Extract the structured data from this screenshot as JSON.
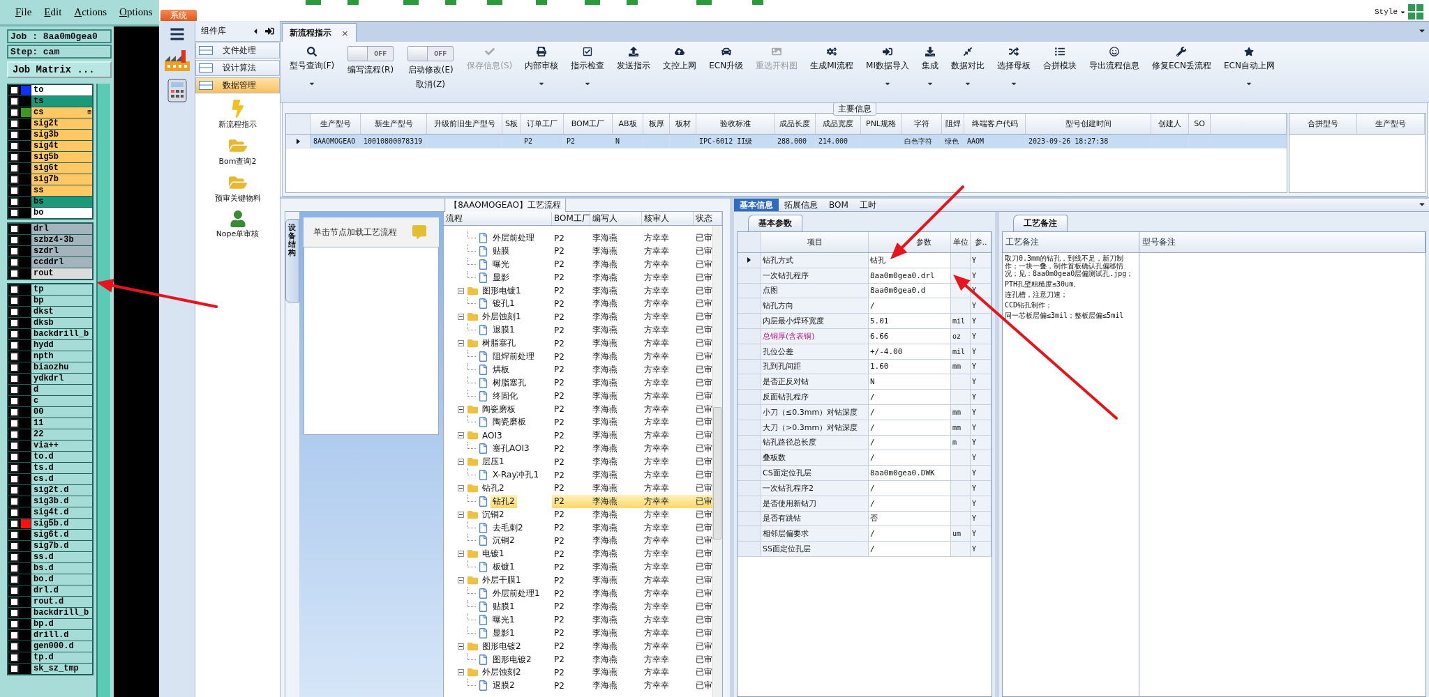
{
  "left_panel": {
    "menu": [
      "File",
      "Edit",
      "Actions",
      "Options"
    ],
    "job": "Job : 8aa0m0gea0",
    "step": "Step: cam",
    "matrix_button": "Job Matrix ...",
    "layer_groups": [
      {
        "layers": [
          {
            "name": "to",
            "color": "#ffffff",
            "swatch": {
              "color": "#1030ff"
            },
            "checked": false
          },
          {
            "name": "ts",
            "color": "#1a9a7a",
            "checked": false
          },
          {
            "name": "cs",
            "color": "#ffc864",
            "swatch": {
              "color": "#3a9a20"
            },
            "mark": "⊞",
            "checked": false
          },
          {
            "name": "sig2t",
            "color": "#ffc864",
            "checked": false
          },
          {
            "name": "sig3b",
            "color": "#ffc864",
            "checked": false
          },
          {
            "name": "sig4t",
            "color": "#ffc864",
            "checked": false
          },
          {
            "name": "sig5b",
            "color": "#ffc864",
            "checked": false
          },
          {
            "name": "sig6t",
            "color": "#ffc864",
            "checked": false
          },
          {
            "name": "sig7b",
            "color": "#ffc864",
            "checked": false
          },
          {
            "name": "ss",
            "color": "#ffc864",
            "checked": false
          },
          {
            "name": "bs",
            "color": "#1a9a7a",
            "checked": false
          },
          {
            "name": "bo",
            "color": "#ffffff",
            "checked": false
          }
        ]
      },
      {
        "layers": [
          {
            "name": "drl",
            "color": "#a4b4bc",
            "checked": false
          },
          {
            "name": "szbz4-3b",
            "color": "#a4b4bc",
            "checked": false
          },
          {
            "name": "szdrl",
            "color": "#a4b4bc",
            "checked": false
          },
          {
            "name": "ccddrl",
            "color": "#a4b4bc",
            "checked": false
          },
          {
            "name": "rout",
            "color": "#dcdcdc",
            "checked": false
          }
        ]
      },
      {
        "layers": [
          {
            "name": "tp",
            "color": "#a6dcd8",
            "checked": false
          },
          {
            "name": "bp",
            "color": "#a6dcd8",
            "checked": false
          },
          {
            "name": "dkst",
            "color": "#a6dcd8",
            "checked": false
          },
          {
            "name": "dksb",
            "color": "#a6dcd8",
            "checked": false
          },
          {
            "name": "backdrill_b",
            "color": "#a6dcd8",
            "checked": false
          },
          {
            "name": "hydd",
            "color": "#a6dcd8",
            "checked": false
          },
          {
            "name": "npth",
            "color": "#a6dcd8",
            "checked": false
          },
          {
            "name": "biaozhu",
            "color": "#a6dcd8",
            "checked": false
          },
          {
            "name": "ydkdrl",
            "color": "#a6dcd8",
            "checked": false
          },
          {
            "name": "d",
            "color": "#a6dcd8",
            "checked": false
          },
          {
            "name": "c",
            "color": "#a6dcd8",
            "checked": false
          },
          {
            "name": "00",
            "color": "#a6dcd8",
            "checked": false
          },
          {
            "name": "11",
            "color": "#a6dcd8",
            "checked": false
          },
          {
            "name": "22",
            "color": "#a6dcd8",
            "checked": false
          },
          {
            "name": "via++",
            "color": "#a6dcd8",
            "checked": false
          },
          {
            "name": "to.d",
            "color": "#a6dcd8",
            "checked": false
          },
          {
            "name": "ts.d",
            "color": "#a6dcd8",
            "checked": false
          },
          {
            "name": "cs.d",
            "color": "#a6dcd8",
            "checked": false
          },
          {
            "name": "sig2t.d",
            "color": "#a6dcd8",
            "checked": false
          },
          {
            "name": "sig3b.d",
            "color": "#a6dcd8",
            "checked": false
          },
          {
            "name": "sig4t.d",
            "color": "#a6dcd8",
            "checked": false
          },
          {
            "name": "sig5b.d",
            "color": "#a6dcd8",
            "swatch": {
              "color": "#ff1010"
            },
            "checked": false
          },
          {
            "name": "sig6t.d",
            "color": "#a6dcd8",
            "checked": false
          },
          {
            "name": "sig7b.d",
            "color": "#a6dcd8",
            "checked": false
          },
          {
            "name": "ss.d",
            "color": "#a6dcd8",
            "checked": false
          },
          {
            "name": "bs.d",
            "color": "#a6dcd8",
            "checked": false
          },
          {
            "name": "bo.d",
            "color": "#a6dcd8",
            "checked": false
          },
          {
            "name": "drl.d",
            "color": "#a6dcd8",
            "checked": false
          },
          {
            "name": "rout.d",
            "color": "#a6dcd8",
            "checked": false
          },
          {
            "name": "backdrill_b",
            "color": "#a6dcd8",
            "checked": false
          },
          {
            "name": "bp.d",
            "color": "#a6dcd8",
            "checked": false
          },
          {
            "name": "drill.d",
            "color": "#a6dcd8",
            "checked": false
          },
          {
            "name": "gen000.d",
            "color": "#a6dcd8",
            "checked": false
          },
          {
            "name": "tp.d",
            "color": "#a6dcd8",
            "checked": false
          },
          {
            "name": "sk_sz_tmp",
            "color": "#a6dcd8",
            "checked": false
          }
        ]
      }
    ]
  },
  "app": {
    "system_tab": "系统",
    "style_menu": "Style",
    "component_library": {
      "title": "组件库",
      "categories": [
        {
          "label": "文件处理",
          "selected": false
        },
        {
          "label": "设计算法",
          "selected": false
        },
        {
          "label": "数据管理",
          "selected": true
        }
      ],
      "items": [
        "新流程指示",
        "Bom查询2",
        "预审关键物料",
        "Nope单审核"
      ]
    },
    "doc_tabs": [
      {
        "label": "新流程指示",
        "close": "×",
        "selected": true
      }
    ],
    "toolbar": [
      {
        "kind": "button",
        "label": "型号查询(F)",
        "dropdown": true,
        "disabled": false
      },
      {
        "kind": "toggle",
        "label": "编写流程(R)",
        "switch": "OFF",
        "on": false
      },
      {
        "kind": "toggle",
        "label": "启动修改(E)",
        "label2": "取消(Z)",
        "switch": "OFF",
        "on": false
      },
      {
        "kind": "button",
        "label": "保存信息(S)",
        "dropdown": false,
        "disabled": true
      },
      {
        "kind": "button",
        "label": "内部审核",
        "dropdown": true,
        "disabled": false
      },
      {
        "kind": "button",
        "label": "指示检查",
        "dropdown": true,
        "disabled": false
      },
      {
        "kind": "button",
        "label": "发送指示",
        "dropdown": false,
        "disabled": false
      },
      {
        "kind": "button",
        "label": "文控上网",
        "dropdown": false,
        "disabled": false
      },
      {
        "kind": "button",
        "label": "ECN升级",
        "dropdown": false,
        "disabled": false
      },
      {
        "kind": "button",
        "label": "重选开料图",
        "dropdown": false,
        "disabled": true
      },
      {
        "kind": "button",
        "label": "生成MI流程",
        "dropdown": false,
        "disabled": false
      },
      {
        "kind": "button",
        "label": "MI数据导入",
        "dropdown": true,
        "disabled": false
      },
      {
        "kind": "button",
        "label": "集成",
        "dropdown": true,
        "disabled": false
      },
      {
        "kind": "button",
        "label": "数据对比",
        "dropdown": true,
        "disabled": false
      },
      {
        "kind": "button",
        "label": "选择母板",
        "dropdown": true,
        "disabled": false
      },
      {
        "kind": "button",
        "label": "合拼模块",
        "dropdown": false,
        "disabled": false
      },
      {
        "kind": "button",
        "label": "导出流程信息",
        "dropdown": false,
        "disabled": false
      },
      {
        "kind": "button",
        "label": "修复ECN丢流程",
        "dropdown": false,
        "disabled": false
      },
      {
        "kind": "button",
        "label": "ECN自动上网",
        "dropdown": true,
        "disabled": false
      }
    ],
    "main_info": {
      "title": "主要信息",
      "columns": [
        "生产型号",
        "新生产型号",
        "升级前旧生产型号",
        "S板",
        "订单工厂",
        "BOM工厂",
        "AB板",
        "板厚",
        "板材",
        "验收标准",
        "成品长度",
        "成品宽度",
        "PNL规格",
        "字符",
        "阻焊",
        "终端客户代码",
        "型号创建时间",
        "创建人",
        "SO"
      ],
      "rows": [
        {
          "selected": true,
          "cells": [
            "8AAOMOGEAO",
            "10010800078319",
            "",
            "",
            "P2",
            "P2",
            "N",
            "",
            "",
            "IPC-6012 II级",
            "288.000",
            "214.000",
            "",
            "白色字符",
            "绿色",
            "AAOM",
            "2023-09-26 18:27:38",
            "",
            ""
          ]
        }
      ]
    },
    "merge_table": {
      "columns": [
        "合拼型号",
        "生产型号"
      ]
    },
    "flow": {
      "title": "【8AAOMOGEAO】工艺流程",
      "side_tab": "设备结构",
      "hint": "单击节点加载工艺流程",
      "columns": [
        "流程",
        "BOM工厂",
        "编写人",
        "核审人",
        "状态"
      ],
      "tree": [
        {
          "children": [
            {
              "label": "外层前处理",
              "bom": "P2",
              "writer": "李海燕",
              "reviewer": "方幸幸",
              "status": "已审",
              "selected": false
            },
            {
              "label": "贴膜",
              "bom": "P2",
              "writer": "李海燕",
              "reviewer": "方幸幸",
              "status": "已审",
              "selected": false
            },
            {
              "label": "曝光",
              "bom": "P2",
              "writer": "李海燕",
              "reviewer": "方幸幸",
              "status": "已审",
              "selected": false
            },
            {
              "label": "显影",
              "bom": "P2",
              "writer": "李海燕",
              "reviewer": "方幸幸",
              "status": "已审",
              "selected": false
            }
          ]
        },
        {
          "label": "图形电镀1",
          "bom": "P2",
          "writer": "李海燕",
          "reviewer": "方幸幸",
          "status": "已审",
          "selected": false,
          "expanded": true,
          "children": [
            {
              "label": "镀孔1",
              "bom": "P2",
              "writer": "李海燕",
              "reviewer": "方幸幸",
              "status": "已审",
              "selected": false
            }
          ]
        },
        {
          "label": "外层蚀刻1",
          "bom": "P2",
          "writer": "李海燕",
          "reviewer": "方幸幸",
          "status": "已审",
          "selected": false,
          "expanded": true,
          "children": [
            {
              "label": "退膜1",
              "bom": "P2",
              "writer": "李海燕",
              "reviewer": "方幸幸",
              "status": "已审",
              "selected": false
            }
          ]
        },
        {
          "label": "树脂塞孔",
          "bom": "P2",
          "writer": "李海燕",
          "reviewer": "方幸幸",
          "status": "已审",
          "selected": false,
          "expanded": true,
          "children": [
            {
              "label": "阻焊前处理",
              "bom": "P2",
              "writer": "李海燕",
              "reviewer": "方幸幸",
              "status": "已审",
              "selected": false
            },
            {
              "label": "烘板",
              "bom": "P2",
              "writer": "李海燕",
              "reviewer": "方幸幸",
              "status": "已审",
              "selected": false
            },
            {
              "label": "树脂塞孔",
              "bom": "P2",
              "writer": "李海燕",
              "reviewer": "方幸幸",
              "status": "已审",
              "selected": false
            },
            {
              "label": "终固化",
              "bom": "P2",
              "writer": "李海燕",
              "reviewer": "方幸幸",
              "status": "已审",
              "selected": false
            }
          ]
        },
        {
          "label": "陶瓷磨板",
          "bom": "P2",
          "writer": "李海燕",
          "reviewer": "方幸幸",
          "status": "已审",
          "selected": false,
          "expanded": true,
          "children": [
            {
              "label": "陶瓷磨板",
              "bom": "P2",
              "writer": "李海燕",
              "reviewer": "方幸幸",
              "status": "已审",
              "selected": false
            }
          ]
        },
        {
          "label": "AOI3",
          "bom": "P2",
          "writer": "李海燕",
          "reviewer": "方幸幸",
          "status": "已审",
          "selected": false,
          "expanded": true,
          "children": [
            {
              "label": "塞孔AOI3",
              "bom": "P2",
              "writer": "李海燕",
              "reviewer": "方幸幸",
              "status": "已审",
              "selected": false
            }
          ]
        },
        {
          "label": "层压1",
          "bom": "P2",
          "writer": "李海燕",
          "reviewer": "方幸幸",
          "status": "已审",
          "selected": false,
          "expanded": true,
          "children": [
            {
              "label": "X-Ray冲孔1",
              "bom": "P2",
              "writer": "李海燕",
              "reviewer": "方幸幸",
              "status": "已审",
              "selected": false
            }
          ]
        },
        {
          "label": "钻孔2",
          "bom": "P2",
          "writer": "李海燕",
          "reviewer": "方幸幸",
          "status": "已审",
          "selected": false,
          "expanded": true,
          "children": [
            {
              "label": "钻孔2",
              "bom": "P2",
              "writer": "李海燕",
              "reviewer": "方幸幸",
              "status": "已审",
              "selected": true
            }
          ]
        },
        {
          "label": "沉铜2",
          "bom": "P2",
          "writer": "李海燕",
          "reviewer": "方幸幸",
          "status": "已审",
          "selected": false,
          "expanded": true,
          "children": [
            {
              "label": "去毛刺2",
              "bom": "P2",
              "writer": "李海燕",
              "reviewer": "方幸幸",
              "status": "已审",
              "selected": false
            },
            {
              "label": "沉铜2",
              "bom": "P2",
              "writer": "李海燕",
              "reviewer": "方幸幸",
              "status": "已审",
              "selected": false
            }
          ]
        },
        {
          "label": "电镀1",
          "bom": "P2",
          "writer": "李海燕",
          "reviewer": "方幸幸",
          "status": "已审",
          "selected": false,
          "expanded": true,
          "children": [
            {
              "label": "板镀1",
              "bom": "P2",
              "writer": "李海燕",
              "reviewer": "方幸幸",
              "status": "已审",
              "selected": false
            }
          ]
        },
        {
          "label": "外层干膜1",
          "bom": "P2",
          "writer": "李海燕",
          "reviewer": "方幸幸",
          "status": "已审",
          "selected": false,
          "expanded": true,
          "children": [
            {
              "label": "外层前处理1",
              "bom": "P2",
              "writer": "李海燕",
              "reviewer": "方幸幸",
              "status": "已审",
              "selected": false
            },
            {
              "label": "贴膜1",
              "bom": "P2",
              "writer": "李海燕",
              "reviewer": "方幸幸",
              "status": "已审",
              "selected": false
            },
            {
              "label": "曝光1",
              "bom": "P2",
              "writer": "李海燕",
              "reviewer": "方幸幸",
              "status": "已审",
              "selected": false
            },
            {
              "label": "显影1",
              "bom": "P2",
              "writer": "李海燕",
              "reviewer": "方幸幸",
              "status": "已审",
              "selected": false
            }
          ]
        },
        {
          "label": "图形电镀2",
          "bom": "P2",
          "writer": "李海燕",
          "reviewer": "方幸幸",
          "status": "已审",
          "selected": false,
          "expanded": true,
          "children": [
            {
              "label": "图形电镀2",
              "bom": "P2",
              "writer": "李海燕",
              "reviewer": "方幸幸",
              "status": "已审",
              "selected": false
            }
          ]
        },
        {
          "label": "外层蚀刻2",
          "bom": "P2",
          "writer": "李海燕",
          "reviewer": "方幸幸",
          "status": "已审",
          "selected": false,
          "expanded": true,
          "children": [
            {
              "label": "退膜2",
              "bom": "P2",
              "writer": "李海燕",
              "reviewer": "方幸幸",
              "status": "已审",
              "selected": false
            }
          ]
        }
      ]
    },
    "detail_tabs": [
      {
        "label": "基本信息",
        "selected": true
      },
      {
        "label": "拓展信息",
        "selected": false
      },
      {
        "label": "BOM",
        "selected": false
      },
      {
        "label": "工时",
        "selected": false
      }
    ],
    "basic_params": {
      "tab": "基本参数",
      "columns": [
        "项目",
        "参数",
        "单位",
        "参.."
      ],
      "rows": [
        {
          "item": "钻孔方式",
          "value": "钻孔",
          "unit": "",
          "flag": "Y",
          "emphasis": false,
          "selected": true
        },
        {
          "item": "一次钻孔程序",
          "value": "8aa0m0gea0.drl",
          "unit": "",
          "flag": "Y",
          "emphasis": false,
          "selected": false
        },
        {
          "item": "点图",
          "value": "8aa0m0gea0.d",
          "unit": "",
          "flag": "Y",
          "emphasis": false,
          "selected": false
        },
        {
          "item": "钻孔方向",
          "value": "/",
          "unit": "",
          "flag": "Y",
          "emphasis": false,
          "selected": false
        },
        {
          "item": "内层最小焊环宽度",
          "value": "5.01",
          "unit": "mil",
          "flag": "Y",
          "emphasis": false,
          "selected": false
        },
        {
          "item": "总铜厚(含表铜)",
          "value": "6.66",
          "unit": "oz",
          "flag": "Y",
          "emphasis": true,
          "selected": false
        },
        {
          "item": "孔位公差",
          "value": "+/-4.00",
          "unit": "mil",
          "flag": "Y",
          "emphasis": false,
          "selected": false
        },
        {
          "item": "孔到孔间距",
          "value": "1.60",
          "unit": "mm",
          "flag": "Y",
          "emphasis": false,
          "selected": false
        },
        {
          "item": "是否正反对钻",
          "value": "N",
          "unit": "",
          "flag": "Y",
          "emphasis": false,
          "selected": false
        },
        {
          "item": "反面钻孔程序",
          "value": "/",
          "unit": "",
          "flag": "Y",
          "emphasis": false,
          "selected": false
        },
        {
          "item": "小刀（≤0.3mm）对钻深度",
          "value": "/",
          "unit": "mm",
          "flag": "Y",
          "emphasis": false,
          "selected": false
        },
        {
          "item": "大刀（>0.3mm）对钻深度",
          "value": "/",
          "unit": "mm",
          "flag": "Y",
          "emphasis": false,
          "selected": false
        },
        {
          "item": "钻孔路径总长度",
          "value": "/",
          "unit": "m",
          "flag": "Y",
          "emphasis": false,
          "selected": false
        },
        {
          "item": "叠板数",
          "value": "/",
          "unit": "",
          "flag": "Y",
          "emphasis": false,
          "selected": false
        },
        {
          "item": "CS面定位孔层",
          "value": "8aa0m0gea0.DWK",
          "unit": "",
          "flag": "Y",
          "emphasis": false,
          "selected": false
        },
        {
          "item": "一次钻孔程序2",
          "value": "/",
          "unit": "",
          "flag": "Y",
          "emphasis": false,
          "selected": false
        },
        {
          "item": "是否使用新钻刀",
          "value": "/",
          "unit": "",
          "flag": "Y",
          "emphasis": false,
          "selected": false
        },
        {
          "item": "是否有跳钻",
          "value": "否",
          "unit": "",
          "flag": "Y",
          "emphasis": false,
          "selected": false
        },
        {
          "item": "相邻层偏要求",
          "value": "/",
          "unit": "um",
          "flag": "Y",
          "emphasis": false,
          "selected": false
        },
        {
          "item": "SS面定位孔层",
          "value": "/",
          "unit": "",
          "flag": "Y",
          "emphasis": false,
          "selected": false
        }
      ]
    },
    "notes": {
      "tab": "工艺备注",
      "columns": [
        "工艺备注",
        "型号备注"
      ],
      "paragraphs": [
        "取刀0.3mm的钻孔，到线不足，新刀制作；一块一叠，制作首板确认孔偏移情况；见：8aa0m0gea0层偏测试孔.jpg；",
        "PTH孔壁粗糙度≤30um。",
        "连孔槽，注意刀速；",
        "CCD钻孔制作；",
        "同一芯板层偏≤3mil；整板层偏≤5mil"
      ]
    }
  }
}
